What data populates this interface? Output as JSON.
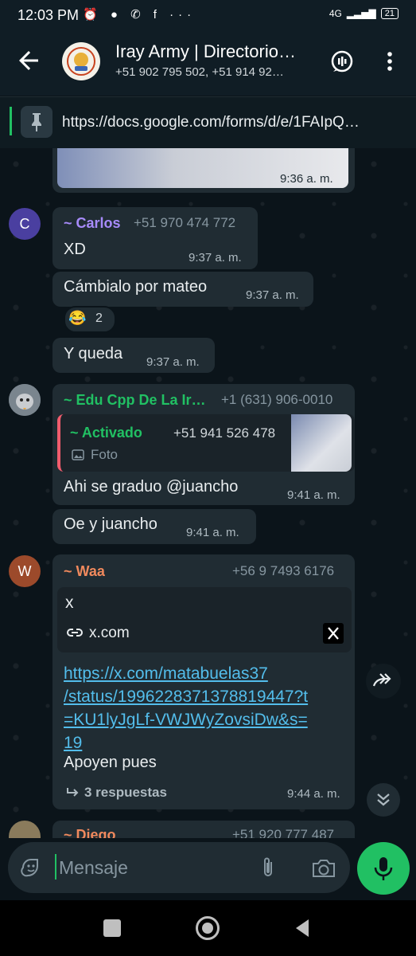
{
  "status": {
    "time": "12:03 PM",
    "icons": "⏰ ● ✆ f ···",
    "network": "4G",
    "battery": "21"
  },
  "header": {
    "title": "Iray Army | Directorio…",
    "subtitle": "+51 902 795 502, +51 914 92…"
  },
  "pinned": {
    "text": "https://docs.google.com/forms/d/e/1FAIpQ…"
  },
  "messages": {
    "m0": {
      "time": "9:36 a. m."
    },
    "m1": {
      "avatar_letter": "C",
      "sender": "~ Carlos",
      "phone": "+51 970 474 772",
      "text": "XD",
      "time": "9:37 a. m."
    },
    "m2": {
      "text": "Cámbialo por mateo",
      "time": "9:37 a. m.",
      "reaction_emoji": "😂",
      "reaction_count": "2"
    },
    "m3": {
      "text": "Y queda",
      "time": "9:37 a. m."
    },
    "m4": {
      "sender": "~ Edu Cpp De La Ir…",
      "phone": "+1 (631) 906-0010",
      "quote_sender": "~ Activado",
      "quote_phone": "+51 941 526 478",
      "quote_type": "Foto",
      "text": "Ahi se graduo @juancho",
      "time": "9:41 a. m."
    },
    "m5": {
      "text": "Oe y juancho",
      "time": "9:41 a. m."
    },
    "m6": {
      "avatar_letter": "W",
      "sender": "~ Waa",
      "phone": "+56 9 7493 6176",
      "preview_title": "x",
      "preview_domain": "x.com",
      "link_lines": [
        "https://x.com/matabuelas37",
        "/status/1996228371378819447?t",
        "=KU1lyJgLf-VWJWyZovsiDw&s=",
        "19"
      ],
      "text": "Apoyen pues",
      "replies": "3 respuestas",
      "time": "9:44 a. m."
    },
    "m7": {
      "sender": "~ Diego",
      "phone": "+51 920 777 487"
    }
  },
  "input": {
    "placeholder": "Mensaje"
  },
  "colors": {
    "accent": "#21c063",
    "carlos": "#a78bfa",
    "edu": "#21c063",
    "activado": "#21c063",
    "waa": "#f0895d",
    "link": "#53bdeb",
    "bubble": "#202c33",
    "background": "#0b141a"
  }
}
